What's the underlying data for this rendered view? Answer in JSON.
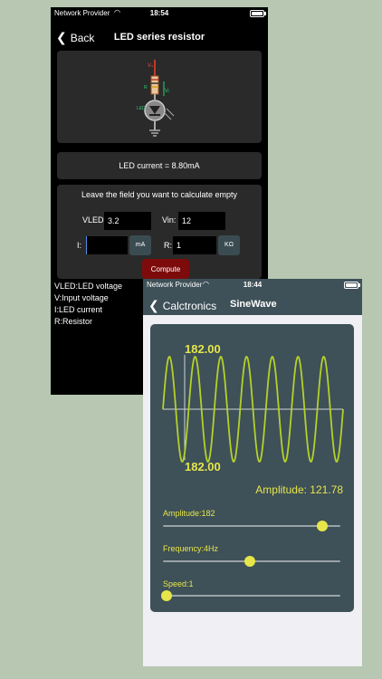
{
  "phone1": {
    "status": {
      "carrier": "Network Provider",
      "time": "18:54"
    },
    "nav": {
      "back_label": "Back",
      "title": "LED series resistor"
    },
    "circuit_labels": {
      "vin": "Vₛ",
      "resistor": "R",
      "vled": "Vₗ",
      "led": "LED"
    },
    "current_text": "LED current = 8.80mA",
    "form": {
      "hint": "Leave the field you want to calculate empty",
      "vled_label": "VLED:",
      "vled_value": "3.2",
      "vin_label": "Vin:",
      "vin_value": "12",
      "i_label": "I:",
      "i_value": "",
      "i_unit": "mA",
      "r_label": "R:",
      "r_value": "1",
      "r_unit": "KΩ",
      "compute_label": "Compute"
    },
    "legend": [
      "VLED:LED voltage",
      "V:Input voltage",
      "I:LED current",
      "R:Resistor"
    ]
  },
  "phone2": {
    "status": {
      "carrier": "Network Provider",
      "time": "18:44"
    },
    "nav": {
      "back_label": "Calctronics",
      "title": "SineWave"
    },
    "wave": {
      "top_label": "182.00",
      "bottom_label": "182.00",
      "cycles": 7
    },
    "amplitude_readout": "Amplitude: 121.78",
    "sliders": [
      {
        "label": "Amplitude:182",
        "fraction": 0.9
      },
      {
        "label": "Frequency:4Hz",
        "fraction": 0.49
      },
      {
        "label": "Speed:1",
        "fraction": 0.02
      }
    ]
  },
  "colors": {
    "accent": "#e6e64a",
    "wave": "#b4d12a",
    "panel": "#3e5058",
    "compute": "#7e0b0b",
    "background": "#b7c7b1"
  }
}
